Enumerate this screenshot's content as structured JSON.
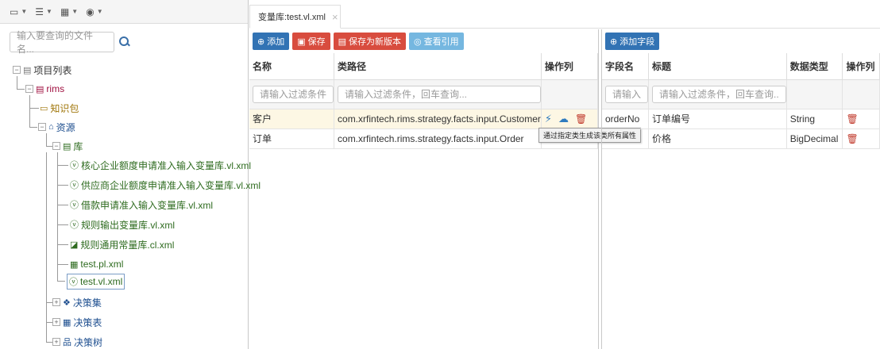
{
  "toolbar": {
    "btn1_icon": "monitor-icon",
    "btn2_icon": "list-icon",
    "btn3_icon": "grid-icon",
    "btn4_icon": "globe-icon"
  },
  "search": {
    "placeholder": "输入要查询的文件名..."
  },
  "tree": {
    "root": "项目列表",
    "project": "rims",
    "knowledge": "知识包",
    "resources": "资源",
    "library": "库",
    "items": [
      "核心企业额度申请准入输入变量库.vl.xml",
      "供应商企业额度申请准入输入变量库.vl.xml",
      "借款申请准入输入变量库.vl.xml",
      "规则输出变量库.vl.xml",
      "规则通用常量库.cl.xml",
      "test.pl.xml",
      "test.vl.xml"
    ],
    "decision_set": "决策集",
    "decision_table": "决策表",
    "decision_tree": "决策树"
  },
  "tab": {
    "label": "变量库:test.vl.xml",
    "close": "×"
  },
  "mid": {
    "buttons": {
      "add": "添加",
      "save": "保存",
      "save_new": "保存为新版本",
      "view_ref": "查看引用"
    },
    "headers": {
      "name": "名称",
      "class_path": "类路径",
      "ops": "操作列"
    },
    "filter": {
      "name_ph": "请输入过滤条件",
      "path_ph": "请输入过滤条件，回车查询..."
    },
    "rows": [
      {
        "name": "客户",
        "path": "com.xrfintech.rims.strategy.facts.input.Customer"
      },
      {
        "name": "订单",
        "path": "com.xrfintech.rims.strategy.facts.input.Order"
      }
    ],
    "tooltip": "通过指定类生成该类所有属性"
  },
  "right": {
    "buttons": {
      "add_field": "添加字段"
    },
    "headers": {
      "field": "字段名",
      "title": "标题",
      "type": "数据类型",
      "ops": "操作列"
    },
    "filter": {
      "field_ph": "请输入",
      "title_ph": "请输入过滤条件，回车查询.."
    },
    "rows": [
      {
        "field": "orderNo",
        "title": "订单编号",
        "type": "String"
      },
      {
        "field": "price",
        "title": "价格",
        "type": "BigDecimal"
      }
    ]
  }
}
